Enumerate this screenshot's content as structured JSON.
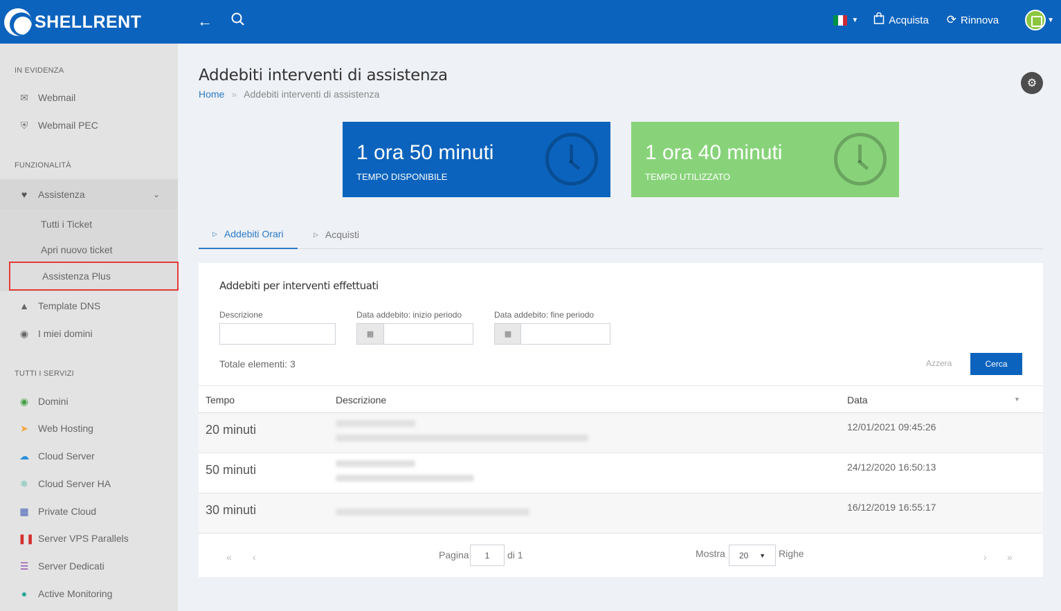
{
  "header": {
    "brand": "SHELLRENT",
    "back_icon": "arrow-left-icon",
    "search_icon": "search-icon",
    "language": "it",
    "buy_label": "Acquista",
    "renew_label": "Rinnova"
  },
  "sidebar": {
    "sections": {
      "featured": "IN EVIDENZA",
      "features": "FUNZIONALITÀ",
      "all_services": "TUTTI I SERVIZI"
    },
    "featured_items": [
      {
        "label": "Webmail",
        "icon": "envelope-icon"
      },
      {
        "label": "Webmail PEC",
        "icon": "shield-icon"
      }
    ],
    "support": {
      "label": "Assistenza",
      "children": [
        "Tutti i Ticket",
        "Apri nuovo ticket",
        "Assistenza Plus"
      ]
    },
    "feature_items": [
      {
        "label": "Template DNS",
        "icon": "road-icon"
      },
      {
        "label": "I miei domini",
        "icon": "globe-icon"
      }
    ],
    "services": [
      {
        "label": "Domini",
        "icon": "globe-icon",
        "color": "#43a047"
      },
      {
        "label": "Web Hosting",
        "icon": "rocket-icon",
        "color": "#f4a53c"
      },
      {
        "label": "Cloud Server",
        "icon": "cloud-icon",
        "color": "#2a8fd8"
      },
      {
        "label": "Cloud Server HA",
        "icon": "atom-icon",
        "color": "#26a69a"
      },
      {
        "label": "Private Cloud",
        "icon": "grid-icon",
        "color": "#3f5fb0"
      },
      {
        "label": "Server VPS Parallels",
        "icon": "parallels-icon",
        "color": "#d32f2f"
      },
      {
        "label": "Server Dedicati",
        "icon": "server-icon",
        "color": "#8e44ad"
      },
      {
        "label": "Active Monitoring",
        "icon": "thermometer-icon",
        "color": "#26a69a"
      }
    ]
  },
  "page": {
    "title": "Addebiti interventi di assistenza",
    "breadcrumb_home": "Home",
    "breadcrumb_sep": "»",
    "breadcrumb_current": "Addebiti interventi di assistenza"
  },
  "stats": {
    "available": {
      "value": "1 ora 50 minuti",
      "label": "TEMPO DISPONIBILE",
      "color": "#0b63bd"
    },
    "used": {
      "value": "1 ora 40 minuti",
      "label": "TEMPO UTILIZZATO",
      "color": "#88d37a"
    }
  },
  "tabs": [
    {
      "label": "Addebiti Orari",
      "active": true
    },
    {
      "label": "Acquisti",
      "active": false
    }
  ],
  "filters": {
    "title": "Addebiti per interventi effettuati",
    "description_label": "Descrizione",
    "description_value": "",
    "start_label": "Data addebito: inizio periodo",
    "start_value": "",
    "end_label": "Data addebito: fine periodo",
    "end_value": "",
    "total": "Totale elementi: 3",
    "reset_label": "Azzera",
    "search_label": "Cerca"
  },
  "table": {
    "columns": [
      "Tempo",
      "Descrizione",
      "Data"
    ],
    "rows": [
      {
        "time": "20 minuti",
        "date": "12/01/2021 09:45:26"
      },
      {
        "time": "50 minuti",
        "date": "24/12/2020 16:50:13"
      },
      {
        "time": "30 minuti",
        "date": "16/12/2019 16:55:17"
      }
    ]
  },
  "pagination": {
    "page_label": "Pagina",
    "page_value": "1",
    "of_label": "di 1",
    "show_label": "Mostra",
    "rows_value": "20",
    "rows_label": "Righe"
  }
}
